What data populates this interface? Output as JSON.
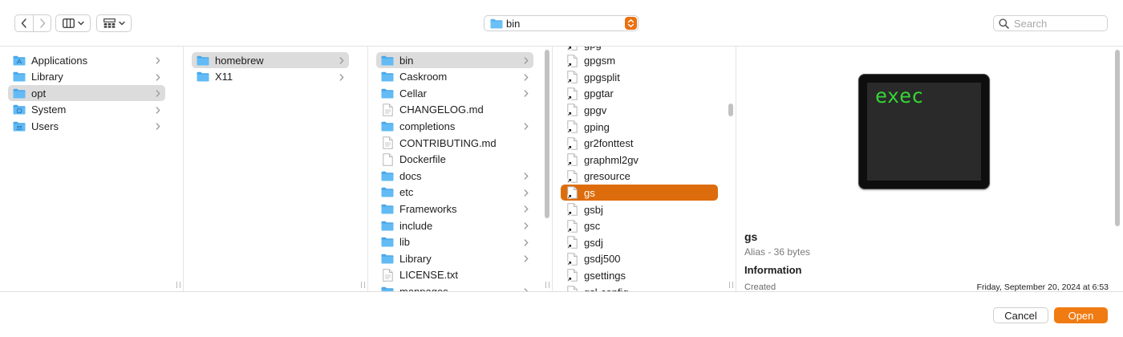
{
  "toolbar": {
    "path_label": "bin",
    "search_placeholder": "Search"
  },
  "columns": [
    {
      "items": [
        {
          "label": "Applications",
          "icon": "applications-folder-icon"
        },
        {
          "label": "Library",
          "icon": "folder-icon"
        },
        {
          "label": "opt",
          "icon": "folder-icon",
          "selected": true
        },
        {
          "label": "System",
          "icon": "system-folder-icon"
        },
        {
          "label": "Users",
          "icon": "users-folder-icon"
        }
      ]
    },
    {
      "items": [
        {
          "label": "homebrew",
          "icon": "folder-icon",
          "selected": true
        },
        {
          "label": "X11",
          "icon": "folder-icon"
        }
      ]
    },
    {
      "items": [
        {
          "label": "bin",
          "icon": "folder-icon",
          "selected": true
        },
        {
          "label": "Caskroom",
          "icon": "folder-icon"
        },
        {
          "label": "Cellar",
          "icon": "folder-icon"
        },
        {
          "label": "CHANGELOG.md",
          "icon": "document-icon"
        },
        {
          "label": "completions",
          "icon": "folder-icon"
        },
        {
          "label": "CONTRIBUTING.md",
          "icon": "document-icon"
        },
        {
          "label": "Dockerfile",
          "icon": "blank-document-icon"
        },
        {
          "label": "docs",
          "icon": "folder-icon"
        },
        {
          "label": "etc",
          "icon": "folder-icon"
        },
        {
          "label": "Frameworks",
          "icon": "folder-icon"
        },
        {
          "label": "include",
          "icon": "folder-icon"
        },
        {
          "label": "lib",
          "icon": "folder-icon"
        },
        {
          "label": "Library",
          "icon": "folder-icon"
        },
        {
          "label": "LICENSE.txt",
          "icon": "document-icon"
        },
        {
          "label": "manpages",
          "icon": "folder-icon"
        }
      ]
    },
    {
      "items": [
        {
          "label": "gpg",
          "icon": "alias-file-icon"
        },
        {
          "label": "gpgsm",
          "icon": "alias-file-icon"
        },
        {
          "label": "gpgsplit",
          "icon": "alias-file-icon"
        },
        {
          "label": "gpgtar",
          "icon": "alias-file-icon"
        },
        {
          "label": "gpgv",
          "icon": "alias-file-icon"
        },
        {
          "label": "gping",
          "icon": "alias-file-icon"
        },
        {
          "label": "gr2fonttest",
          "icon": "alias-file-icon"
        },
        {
          "label": "graphml2gv",
          "icon": "alias-file-icon"
        },
        {
          "label": "gresource",
          "icon": "alias-file-icon"
        },
        {
          "label": "gs",
          "icon": "alias-file-icon",
          "selected": true
        },
        {
          "label": "gsbj",
          "icon": "alias-file-icon"
        },
        {
          "label": "gsc",
          "icon": "alias-file-icon"
        },
        {
          "label": "gsdj",
          "icon": "alias-file-icon"
        },
        {
          "label": "gsdj500",
          "icon": "alias-file-icon"
        },
        {
          "label": "gsettings",
          "icon": "alias-file-icon"
        },
        {
          "label": "gsl-config",
          "icon": "alias-file-icon"
        }
      ]
    }
  ],
  "preview": {
    "thumb_text": "exec",
    "name": "gs",
    "kind": "Alias - 36 bytes",
    "info_heading": "Information",
    "created_label": "Created",
    "created_value": "Friday, September 20, 2024 at 6:53"
  },
  "buttons": {
    "cancel": "Cancel",
    "open": "Open"
  },
  "colors": {
    "accent": "#f07b12",
    "selection_active": "#dd6d0c",
    "folder": "#5bb2f0"
  }
}
